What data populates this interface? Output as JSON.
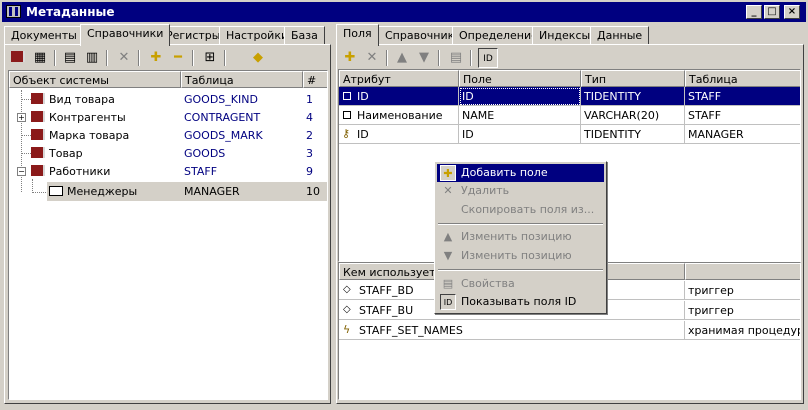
{
  "window": {
    "title": "Метаданные"
  },
  "left": {
    "tabs": [
      "Документы",
      "Справочники",
      "Регистры",
      "Настройки",
      "База"
    ],
    "columns": [
      "Объект системы",
      "Таблица",
      "#"
    ],
    "rows": [
      {
        "name": "Вид товара",
        "table": "GOODS_KIND",
        "num": "1"
      },
      {
        "name": "Контрагенты",
        "table": "CONTRAGENT",
        "num": "4"
      },
      {
        "name": "Марка товара",
        "table": "GOODS_MARK",
        "num": "2"
      },
      {
        "name": "Товар",
        "table": "GOODS",
        "num": "3"
      },
      {
        "name": "Работники",
        "table": "STAFF",
        "num": "9"
      },
      {
        "name": "Менеджеры",
        "table": "MANAGER",
        "num": "10"
      }
    ]
  },
  "right": {
    "tabs": [
      "Поля",
      "Справочник",
      "Определение",
      "Индексы",
      "Данные"
    ],
    "toolbar": {
      "id_label": "ID"
    },
    "columns": [
      "Атрибут",
      "Поле",
      "Тип",
      "Таблица"
    ],
    "rows": [
      {
        "attr": "ID",
        "field": "ID",
        "type": "TIDENTITY",
        "table": "STAFF"
      },
      {
        "attr": "Наименование",
        "field": "NAME",
        "type": "VARCHAR(20)",
        "table": "STAFF"
      },
      {
        "attr": "ID",
        "field": "ID",
        "type": "TIDENTITY",
        "table": "MANAGER"
      }
    ],
    "usage": {
      "header": "Кем используется",
      "rows": [
        {
          "name": "STAFF_BD",
          "kind": "триггер"
        },
        {
          "name": "STAFF_BU",
          "kind": "триггер"
        },
        {
          "name": "STAFF_SET_NAMES",
          "kind": "хранимая процедура"
        }
      ]
    }
  },
  "context_menu": {
    "items": [
      {
        "label": "Добавить поле",
        "icon": "plus-icon"
      },
      {
        "label": "Удалить",
        "icon": "delete-x-icon"
      },
      {
        "label": "Скопировать поля из...",
        "icon": ""
      },
      {
        "label": "Изменить позицию",
        "icon": "arrow-up-icon"
      },
      {
        "label": "Изменить позицию",
        "icon": "arrow-down-icon"
      },
      {
        "label": "Свойства",
        "icon": "properties-icon"
      },
      {
        "label": "Показывать поля ID",
        "icon": "id-icon",
        "badge": "ID"
      }
    ]
  },
  "colors": {
    "selection": "#000080",
    "face": "#d4d0c8",
    "book": "#8b1a1a",
    "accent_plus": "#c8a000"
  }
}
